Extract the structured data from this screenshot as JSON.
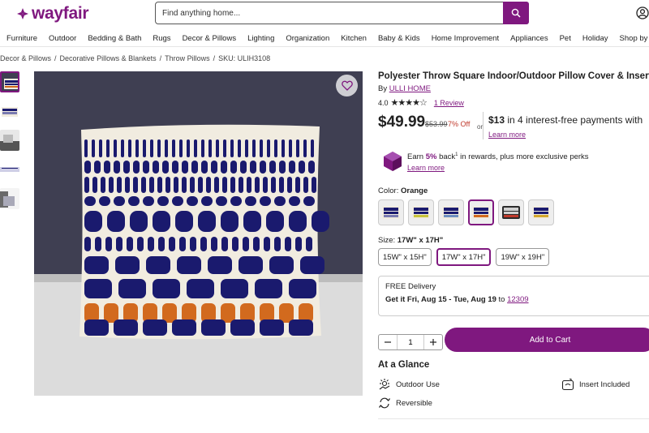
{
  "header": {
    "logo_text": "wayfair",
    "search_placeholder": "Find anything home..."
  },
  "nav": {
    "items": [
      "Furniture",
      "Outdoor",
      "Bedding & Bath",
      "Rugs",
      "Decor & Pillows",
      "Lighting",
      "Organization",
      "Kitchen",
      "Baby & Kids",
      "Home Improvement",
      "Appliances",
      "Pet",
      "Holiday",
      "Shop by Ro"
    ]
  },
  "breadcrumb": {
    "items": [
      "Decor & Pillows",
      "Decorative Pillows & Blankets",
      "Throw Pillows",
      "SKU: ULIH3108"
    ],
    "separator": "/"
  },
  "product": {
    "title": "Polyester Throw Square Indoor/Outdoor Pillow Cover & Insert",
    "by_prefix": "By",
    "brand": "ULLI HOME",
    "rating": "4.0",
    "rating_value": 4,
    "review_link": "1 Review",
    "price": "$49.99",
    "old_price": "$53.99",
    "discount": "7% Off",
    "or_text": "or",
    "installment_amount": "$13",
    "installment_text": "in 4 interest-free payments with",
    "learn_more_1": "Learn more",
    "rewards_prefix": "Earn",
    "rewards_pct": "5%",
    "rewards_suffix": "back",
    "rewards_tail": "in rewards, plus more exclusive perks",
    "learn_more_2": "Learn more",
    "color_label": "Color:",
    "color_value": "Orange",
    "size_label": "Size:",
    "size_value": "17W\" x 17H\"",
    "sizes": [
      "15W\" x 15H\"",
      "17W\" x 17H\"",
      "19W\" x 19H\""
    ],
    "selected_size_index": 1,
    "selected_color_index": 3,
    "delivery_line1": "FREE Delivery",
    "delivery_get": "Get it Fri, Aug 15 - Tue, Aug 19",
    "delivery_to": "to",
    "delivery_zip": "12309",
    "quantity": "1",
    "add_to_cart": "Add to Cart",
    "glance_title": "At a Glance",
    "features": [
      "Outdoor Use",
      "Insert Included",
      "Reversible"
    ]
  },
  "colors": {
    "brand": "#7f187f",
    "pillow_navy": "#1a1a6e",
    "pillow_orange": "#d26a1e",
    "pillow_cream": "#f1ece0",
    "wall": "#3f3f52",
    "floor": "#dcdcdc"
  },
  "icons": [
    "logo-mark-icon",
    "search-icon",
    "account-icon",
    "heart-icon",
    "rewards-gem-icon",
    "outdoor-icon",
    "insert-icon",
    "reversible-icon",
    "minus-icon",
    "plus-icon"
  ]
}
